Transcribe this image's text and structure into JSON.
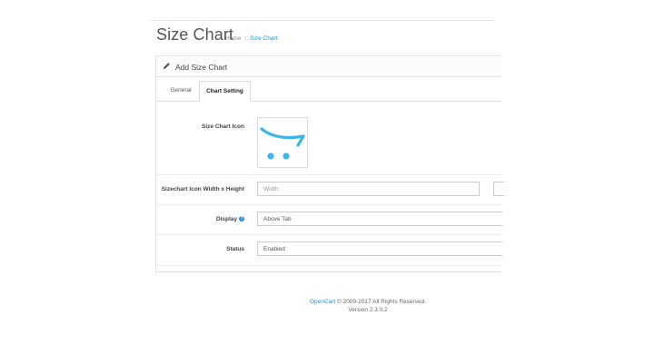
{
  "header": {
    "title": "Size Chart",
    "breadcrumb": [
      {
        "label": "Home"
      },
      {
        "label": "Size Chart"
      }
    ]
  },
  "panel": {
    "title": "Add Size Chart",
    "tabs": [
      {
        "label": "General",
        "active": false
      },
      {
        "label": "Chart Setting",
        "active": true
      }
    ]
  },
  "form": {
    "icon_label": "Size Chart Icon",
    "size_label": "Sizechart Icon Width x Height",
    "width_placeholder": "Width",
    "display_label": "Display",
    "display_value": "Above Tab",
    "status_label": "Status",
    "status_value": "Enabled"
  },
  "footer": {
    "brand": "OpenCart",
    "copyright": "© 2009-2017 All Rights Reserved.",
    "version": "Version 2.3.0.2"
  },
  "colors": {
    "accent": "#1e91cf",
    "cart_icon": "#38b7e8"
  }
}
